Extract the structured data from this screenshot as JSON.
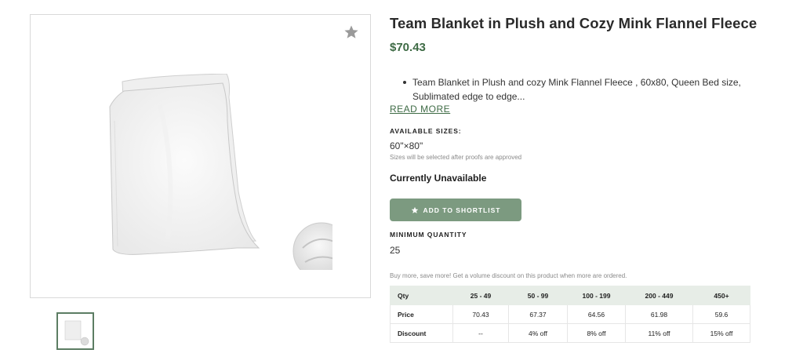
{
  "product": {
    "title": "Team Blanket in Plush and Cozy Mink Flannel Fleece",
    "price": "$70.43",
    "description": "Team Blanket in Plush and cozy Mink Flannel Fleece , 60x80, Queen Bed size, Sublimated edge to edge...",
    "read_more": "READ MORE"
  },
  "sizes": {
    "label": "AVAILABLE SIZES:",
    "value": "60\"×80\"",
    "note": "Sizes will be selected after proofs are approved"
  },
  "availability": "Currently Unavailable",
  "shortlist": {
    "label": "ADD TO SHORTLIST",
    "icon": "star-icon"
  },
  "min_quantity": {
    "label": "MINIMUM QUANTITY",
    "value": "25"
  },
  "volume": {
    "note": "Buy more, save more! Get a volume discount on this product when more are ordered.",
    "headers": [
      "Qty",
      "25 - 49",
      "50 - 99",
      "100 - 199",
      "200 - 449",
      "450+"
    ],
    "price_row": [
      "Price",
      "70.43",
      "67.37",
      "64.56",
      "61.98",
      "59.6"
    ],
    "discount_row": [
      "Discount",
      "--",
      "4% off",
      "8% off",
      "11% off",
      "15% off"
    ]
  },
  "gallery": {
    "favorite_icon": "star-icon",
    "thumbnail_count": 1
  },
  "colors": {
    "accent": "#3e6b45",
    "button": "#7c9a80",
    "table_header": "#e7ede7"
  }
}
